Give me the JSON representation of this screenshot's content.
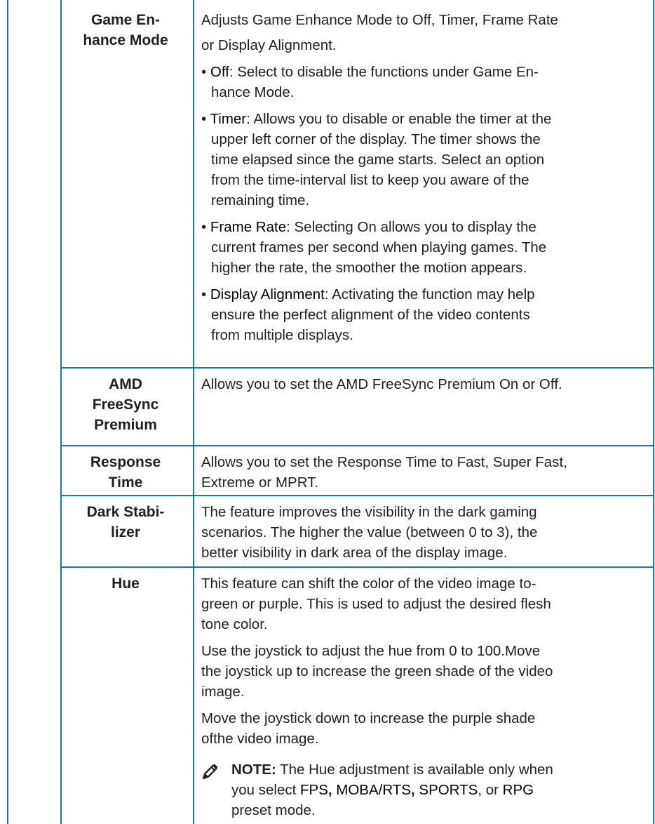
{
  "rows": [
    {
      "name_lines": [
        "Game En-",
        "hance Mode"
      ],
      "paragraphs": [
        [
          "Adjusts Game Enhance Mode to Off, Timer, Frame Rate",
          "or Display Alignment."
        ]
      ],
      "bullets": [
        {
          "term": "Off",
          "lines": [
            ": Select to disable the functions under Game En-",
            "hance Mode."
          ]
        },
        {
          "term": "Timer",
          "lines": [
            ": Allows you to disable or enable the timer at the",
            "upper left corner of the display. The timer shows the",
            "time elapsed since the game starts. Select an option",
            "from the time-interval list to keep you aware of the",
            "remaining time."
          ]
        },
        {
          "term": "Frame Rate",
          "lines": [
            ": Selecting On allows you to display the",
            "current frames per second when playing games. The",
            "higher the rate, the smoother the motion appears."
          ]
        },
        {
          "term": "Display Alignment",
          "lines": [
            ": Activating the function may help",
            "ensure the perfect alignment of the video contents",
            "from multiple displays."
          ]
        }
      ]
    },
    {
      "name_lines": [
        "AMD",
        "FreeSync",
        "Premium"
      ],
      "paragraphs": [
        [
          "Allows you to set the AMD FreeSync Premium On or Off."
        ]
      ]
    },
    {
      "name_lines": [
        "Response",
        "Time"
      ],
      "paragraphs": [
        [
          "Allows you to set the Response Time to Fast, Super Fast,",
          "Extreme or MPRT."
        ]
      ]
    },
    {
      "name_lines": [
        "Dark Stabi-",
        "lizer"
      ],
      "paragraphs": [
        [
          "The feature improves the visibility in the dark gaming",
          "scenarios. The higher the value (between 0 to 3), the",
          "better visibility in dark area of the display image."
        ]
      ]
    },
    {
      "name_lines": [
        "Hue"
      ],
      "paragraphs": [
        [
          "This feature can shift the color of the video image to-",
          "green or purple. This is used to adjust the desired flesh",
          "tone color."
        ],
        [
          "Use the joystick to adjust the hue from 0 to 100.Move",
          "the joystick up to increase the green shade of the video",
          "image."
        ],
        [
          "Move the joystick down to increase the purple shade",
          "ofthe video image."
        ]
      ],
      "note": {
        "label": "NOTE:",
        "line1_rest": " The Hue adjustment is available only when",
        "line2_prefix": "you select ",
        "modes": [
          "FPS",
          "MOBA/RTS",
          "SPORTS",
          "RPG"
        ],
        "sep1": ", ",
        "sep2": ", ",
        "sep3": ", or ",
        "line3": "preset mode."
      }
    }
  ],
  "colors": {
    "rule": "#1a75bc",
    "text": "#231f20",
    "icon": "#231f20"
  }
}
